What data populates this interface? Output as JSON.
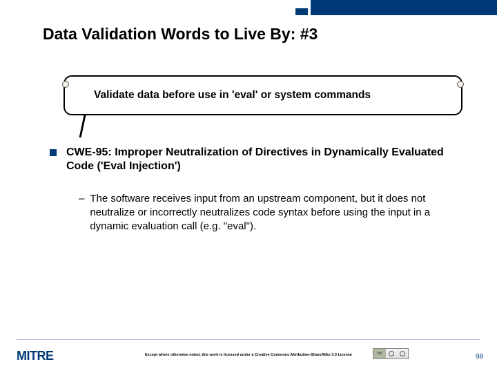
{
  "slide": {
    "title": "Data Validation Words to Live By: #3",
    "callout": "Validate data before use in 'eval' or system commands",
    "bullet": "CWE-95: Improper Neutralization of Directives in Dynamically Evaluated Code ('Eval Injection')",
    "sub": "The software receives input from an upstream component, but it does not neutralize or incorrectly neutralizes code syntax before using the input in a dynamic evaluation call (e.g. \"eval\")."
  },
  "footer": {
    "logo": "MITRE",
    "license": "Except where otherwise noted, this work is licensed under a Creative Commons Attribution-ShareAlike 3.0 License",
    "cc_label": "cc",
    "page": "98"
  }
}
